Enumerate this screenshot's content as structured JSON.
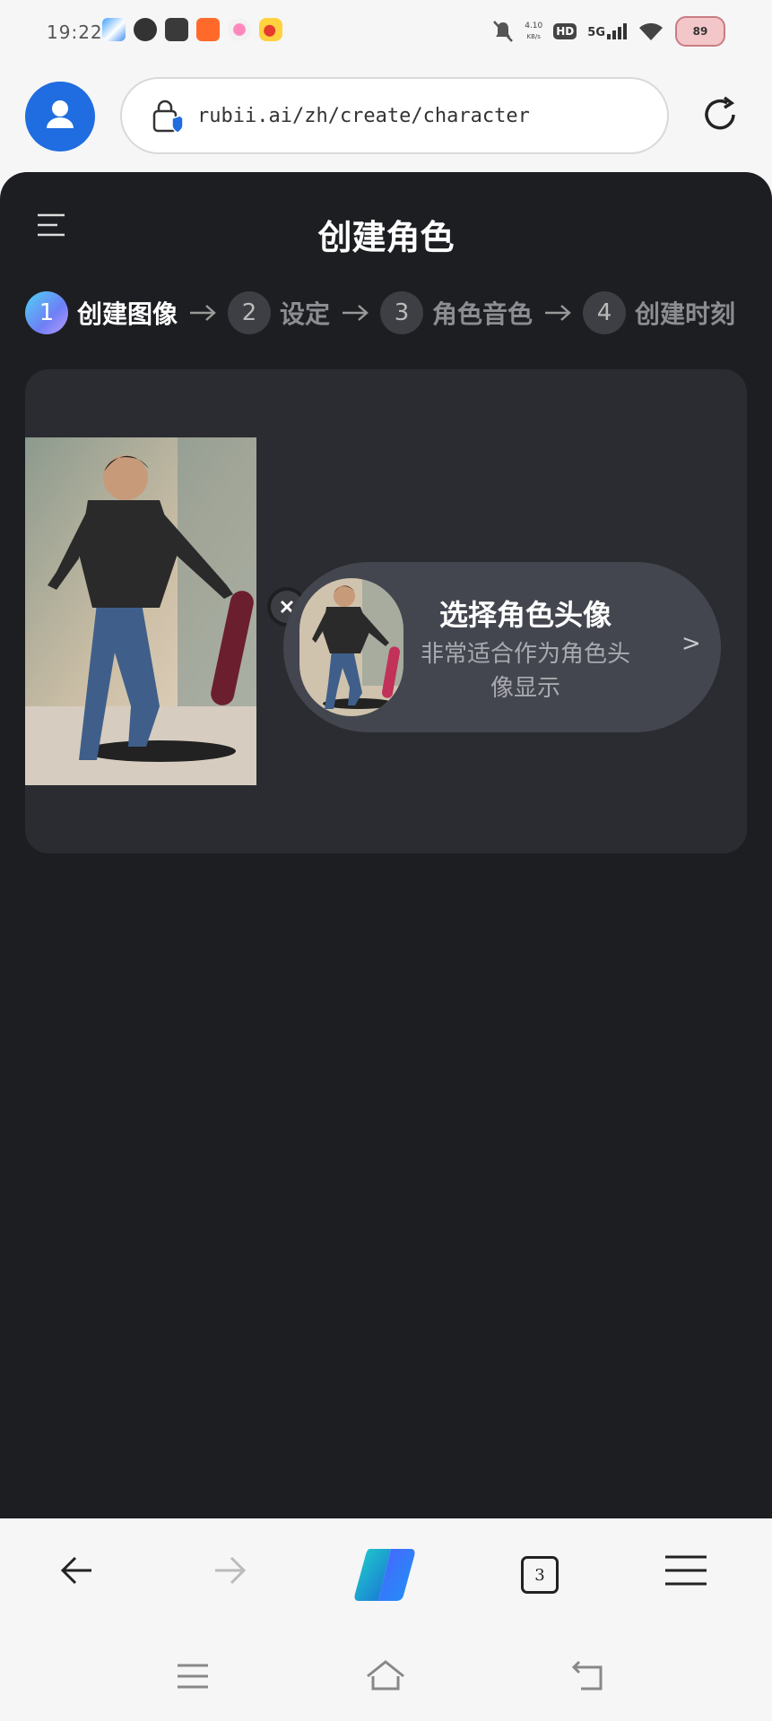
{
  "status_bar": {
    "time": "19:22",
    "net_speed_value": "4.10",
    "net_speed_unit": "KB/s",
    "hd": "HD",
    "network": "5G",
    "battery": "89",
    "app_icons": [
      "map-app-icon",
      "video-app-icon",
      "book-app-icon",
      "shopping-app-icon",
      "camera-app-icon",
      "weibo-app-icon"
    ]
  },
  "browser": {
    "url": "rubii.ai/zh/create/character",
    "tabs_count": "3"
  },
  "page": {
    "title": "创建角色",
    "steps": [
      {
        "number": "1",
        "label": "创建图像",
        "active": true
      },
      {
        "number": "2",
        "label": "设定",
        "active": false
      },
      {
        "number": "3",
        "label": "角色音色",
        "active": false
      },
      {
        "number": "4",
        "label": "创建时刻",
        "active": false
      }
    ],
    "avatar_card": {
      "title": "选择角色头像",
      "subtitle": "非常适合作为角色头像显示",
      "chevron": ">"
    }
  },
  "colors": {
    "background_dark": "#1d1e21",
    "panel": "#2b2c31",
    "card": "#44464f",
    "avatar_blue": "#1f6de0"
  }
}
